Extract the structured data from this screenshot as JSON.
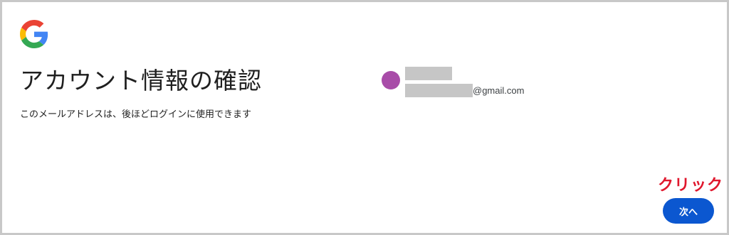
{
  "header": {
    "logo_icon": "google-g-icon"
  },
  "main": {
    "title": "アカウント情報の確認",
    "subtitle": "このメールアドレスは、後ほどログインに使用できます"
  },
  "account": {
    "avatar_color": "#a84ca8",
    "name_redacted": true,
    "email_domain": "@gmail.com"
  },
  "annotation": {
    "text": "クリック",
    "color": "#e0172d"
  },
  "actions": {
    "next_label": "次へ",
    "button_color": "#0b57d0"
  }
}
